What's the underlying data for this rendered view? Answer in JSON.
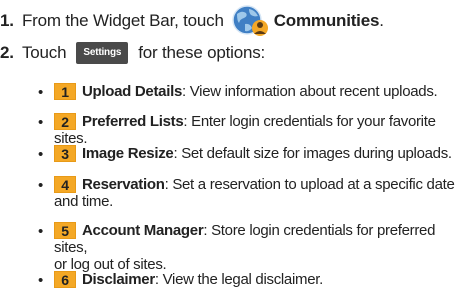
{
  "steps": [
    {
      "num": "1.",
      "prefix": "From the Widget Bar, touch",
      "icon": "communities-globe-icon",
      "term": "Communities",
      "suffix": "."
    },
    {
      "num": "2.",
      "prefix": "Touch",
      "button": "Settings",
      "suffix": "for these options:"
    }
  ],
  "options": [
    {
      "badge": "1",
      "title": "Upload Details",
      "desc": ": View information about recent uploads."
    },
    {
      "badge": "2",
      "title": "Preferred Lists",
      "desc": ": Enter login credentials for your favorite sites."
    },
    {
      "badge": "3",
      "title": "Image Resize",
      "desc": ": Set default size for images during uploads."
    },
    {
      "badge": "4",
      "title": "Reservation",
      "desc": ": Set a reservation to upload at a specific date",
      "desc2": "and time."
    },
    {
      "badge": "5",
      "title": "Account Manager",
      "desc": ": Store login credentials for preferred sites,",
      "desc2": "or log out of sites."
    },
    {
      "badge": "6",
      "title": "Disclaimer",
      "desc": ": View the legal disclaimer."
    }
  ],
  "colors": {
    "badge": "#f4a826",
    "settings_button": "#4a4a4a"
  }
}
